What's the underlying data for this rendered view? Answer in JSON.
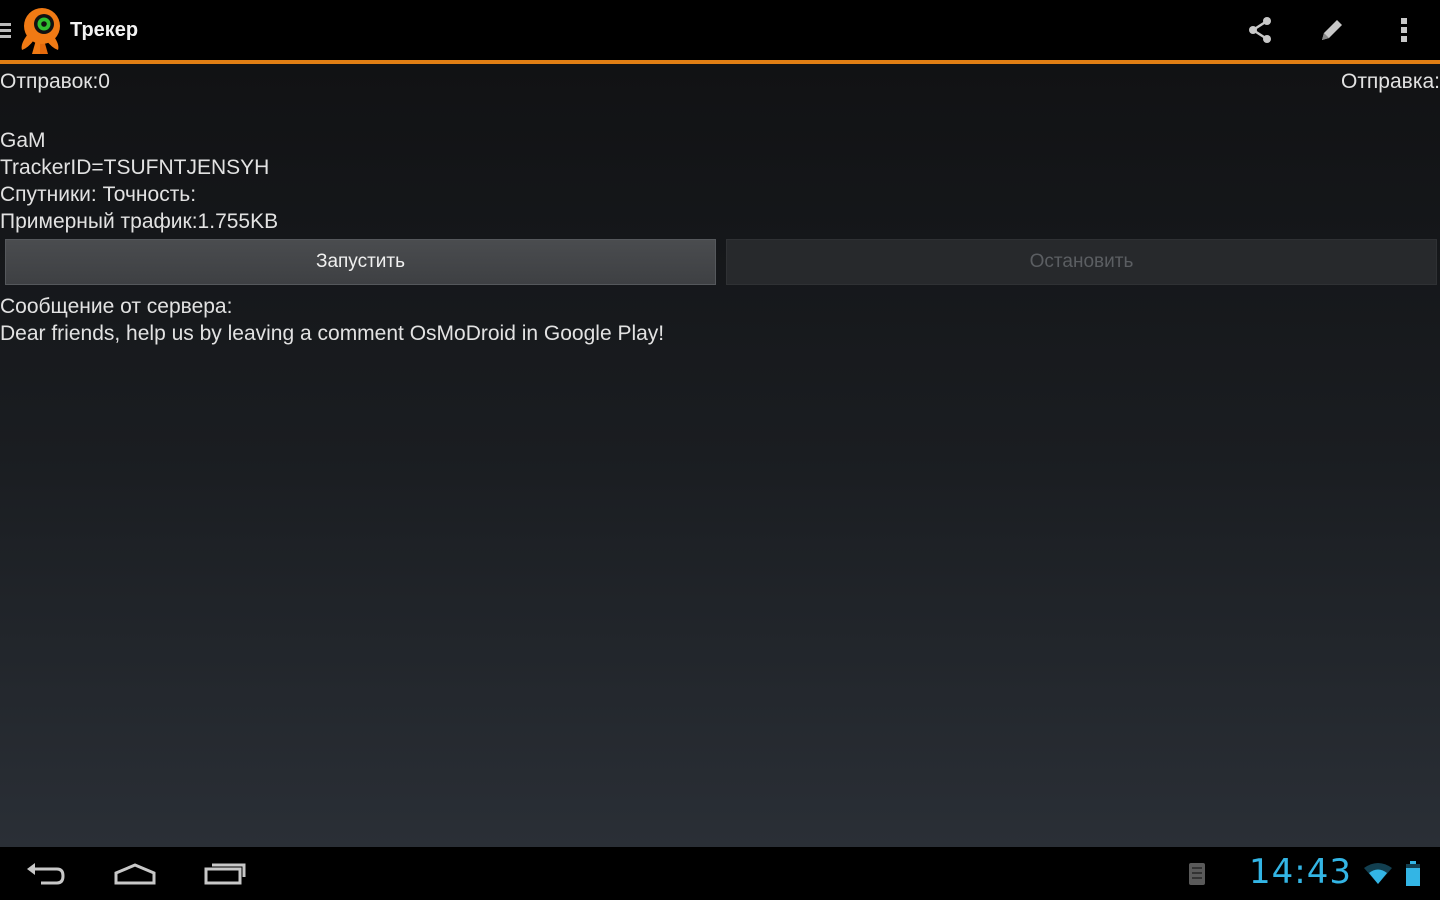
{
  "action_bar": {
    "title": "Трекер",
    "accent_color": "#e07e14",
    "icons": [
      "share-icon",
      "pencil-icon",
      "overflow-menu-icon"
    ]
  },
  "status": {
    "sends_left": "Отправок:0",
    "sends_right": "Отправка:"
  },
  "info": {
    "name": "GaM",
    "tracker_id": "TrackerID=TSUFNTJENSYH",
    "satellites": "Спутники: Точность:",
    "traffic": "Примерный трафик:1.755KB"
  },
  "buttons": {
    "start_label": "Запустить",
    "stop_label": "Остановить"
  },
  "server": {
    "header": "Сообщение от сервера:",
    "message": "Dear friends, help us by leaving a comment OsMoDroid in Google Play!"
  },
  "system_bar": {
    "clock": "14:43",
    "clock_color": "#33b5e5",
    "nav_icons": [
      "back-icon",
      "home-icon",
      "recent-apps-icon"
    ],
    "status_icons": [
      "notification-icon",
      "wifi-icon",
      "battery-icon"
    ]
  }
}
